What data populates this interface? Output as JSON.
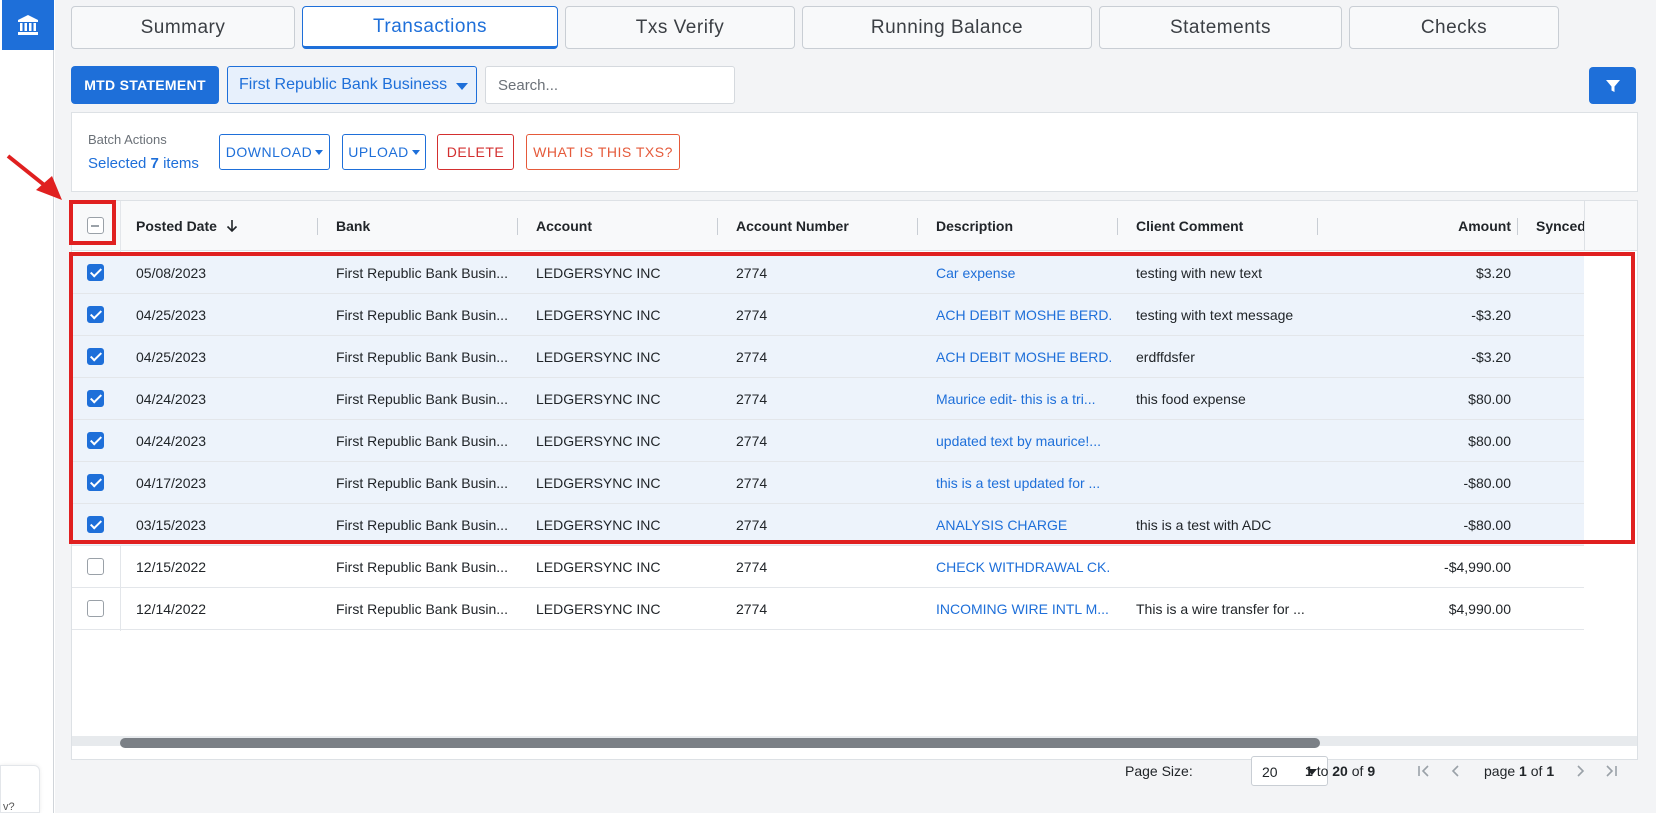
{
  "tabs": [
    {
      "label": "Summary"
    },
    {
      "label": "Transactions"
    },
    {
      "label": "Txs Verify"
    },
    {
      "label": "Running Balance"
    },
    {
      "label": "Statements"
    },
    {
      "label": "Checks"
    }
  ],
  "toolbar": {
    "mtd_label": "MTD STATEMENT",
    "bank_select": "First Republic Bank Business",
    "search_placeholder": "Search..."
  },
  "batch": {
    "label": "Batch Actions",
    "selected_prefix": "Selected",
    "selected_count": "7",
    "selected_suffix": "items",
    "download": "DOWNLOAD",
    "upload": "UPLOAD",
    "delete": "DELETE",
    "what": "WHAT IS THIS TXS?"
  },
  "columns": {
    "posted_date": "Posted Date",
    "bank": "Bank",
    "account": "Account",
    "account_number": "Account Number",
    "description": "Description",
    "client_comment": "Client Comment",
    "amount": "Amount",
    "synced": "Synced I"
  },
  "rows": [
    {
      "checked": true,
      "date": "05/08/2023",
      "bank": "First Republic Bank Busin...",
      "account": "LEDGERSYNC INC",
      "number": "2774",
      "description": "Car expense",
      "comment": "testing with new text",
      "amount": "$3.20"
    },
    {
      "checked": true,
      "date": "04/25/2023",
      "bank": "First Republic Bank Busin...",
      "account": "LEDGERSYNC INC",
      "number": "2774",
      "description": "ACH DEBIT MOSHE BERD...",
      "comment": "testing with text message",
      "amount": "-$3.20"
    },
    {
      "checked": true,
      "date": "04/25/2023",
      "bank": "First Republic Bank Busin...",
      "account": "LEDGERSYNC INC",
      "number": "2774",
      "description": "ACH DEBIT MOSHE BERD...",
      "comment": "erdffdsfer",
      "amount": "-$3.20"
    },
    {
      "checked": true,
      "date": "04/24/2023",
      "bank": "First Republic Bank Busin...",
      "account": "LEDGERSYNC INC",
      "number": "2774",
      "description": "Maurice edit- this is a tri...",
      "comment": "this food expense",
      "amount": "$80.00"
    },
    {
      "checked": true,
      "date": "04/24/2023",
      "bank": "First Republic Bank Busin...",
      "account": "LEDGERSYNC INC",
      "number": "2774",
      "description": "updated text by maurice!...",
      "comment": "",
      "amount": "$80.00"
    },
    {
      "checked": true,
      "date": "04/17/2023",
      "bank": "First Republic Bank Busin...",
      "account": "LEDGERSYNC INC",
      "number": "2774",
      "description": "this is a test updated for ...",
      "comment": "",
      "amount": "-$80.00"
    },
    {
      "checked": true,
      "date": "03/15/2023",
      "bank": "First Republic Bank Busin...",
      "account": "LEDGERSYNC INC",
      "number": "2774",
      "description": "ANALYSIS CHARGE",
      "comment": "this is a test with ADC",
      "amount": "-$80.00"
    },
    {
      "checked": false,
      "date": "12/15/2022",
      "bank": "First Republic Bank Busin...",
      "account": "LEDGERSYNC INC",
      "number": "2774",
      "description": "CHECK WITHDRAWAL CK...",
      "comment": "",
      "amount": "-$4,990.00"
    },
    {
      "checked": false,
      "date": "12/14/2022",
      "bank": "First Republic Bank Busin...",
      "account": "LEDGERSYNC INC",
      "number": "2774",
      "description": "INCOMING WIRE INTL M...",
      "comment": "This is a wire transfer for ...",
      "amount": "$4,990.00"
    }
  ],
  "paging": {
    "page_size_label": "Page Size:",
    "page_size": "20",
    "range_from": "1",
    "range_to_word": "to",
    "range_to": "20",
    "of_word": "of",
    "total": "9",
    "page_word": "page",
    "page": "1",
    "page_of_word": "of",
    "pages": "1"
  },
  "rail": {
    "bottom_text": "v?"
  },
  "colors": {
    "accent": "#1e6fd9",
    "annotation": "#e02020",
    "danger": "#d32f2f"
  }
}
